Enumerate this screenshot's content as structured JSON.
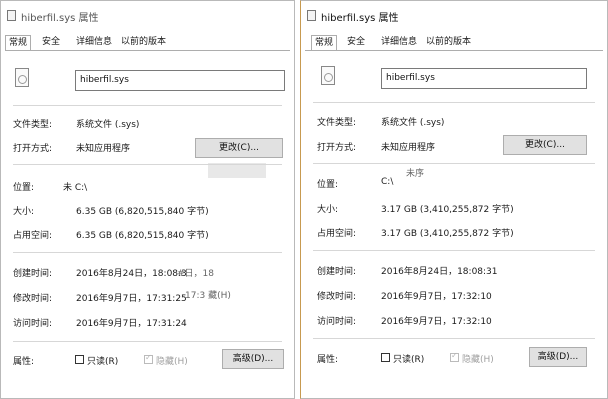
{
  "left": {
    "title": "hiberfil.sys 属性",
    "tabs": [
      "常规",
      "安全",
      "详细信息",
      "以前的版本"
    ],
    "filename": "hiberfil.sys",
    "type_label": "文件类型:",
    "type_value": "系统文件 (.sys)",
    "opens_label": "打开方式:",
    "opens_value": "未知应用程序",
    "change_button": "更改(C)...",
    "location_label": "位置:",
    "location_value": "未 C:\\",
    "size_label": "大小:",
    "size_value": "6.35 GB (6,820,515,840 字节)",
    "disk_label": "占用空间:",
    "disk_value": "6.35 GB (6,820,515,840 字节)",
    "created_label": "创建时间:",
    "created_value": "2016年8月24日，18:08:3",
    "created_ghost": "#日，18",
    "modified_label": "修改时间:",
    "modified_value": "2016年9月7日，17:31:25",
    "modified_ghost": "17:3 藏(H)",
    "accessed_label": "访问时间:",
    "accessed_value": "2016年9月7日，17:31:24",
    "attr_label": "属性:",
    "readonly_label": "只读(R)",
    "hidden_label": "隐藏(H)",
    "advanced_button": "高级(D)..."
  },
  "right": {
    "title": "hiberfil.sys 属性",
    "tabs": [
      "常规",
      "安全",
      "详细信息",
      "以前的版本"
    ],
    "filename": "hiberfil.sys",
    "type_label": "文件类型:",
    "type_value": "系统文件 (.sys)",
    "opens_label": "打开方式:",
    "opens_value": "未知应用程序",
    "change_button": "更改(C)...",
    "location_label": "位置:",
    "location_value": "C:\\",
    "location_ghost": "未序",
    "size_label": "大小:",
    "size_value": "3.17 GB (3,410,255,872 字节)",
    "disk_label": "占用空间:",
    "disk_value": "3.17 GB (3,410,255,872 字节)",
    "created_label": "创建时间:",
    "created_value": "2016年8月24日，18:08:31",
    "modified_label": "修改时间:",
    "modified_value": "2016年9月7日，17:32:10",
    "accessed_label": "访问时间:",
    "accessed_value": "2016年9月7日，17:32:10",
    "attr_label": "属性:",
    "readonly_label": "只读(R)",
    "hidden_label": "隐藏(H)",
    "advanced_button": "高级(D)..."
  }
}
